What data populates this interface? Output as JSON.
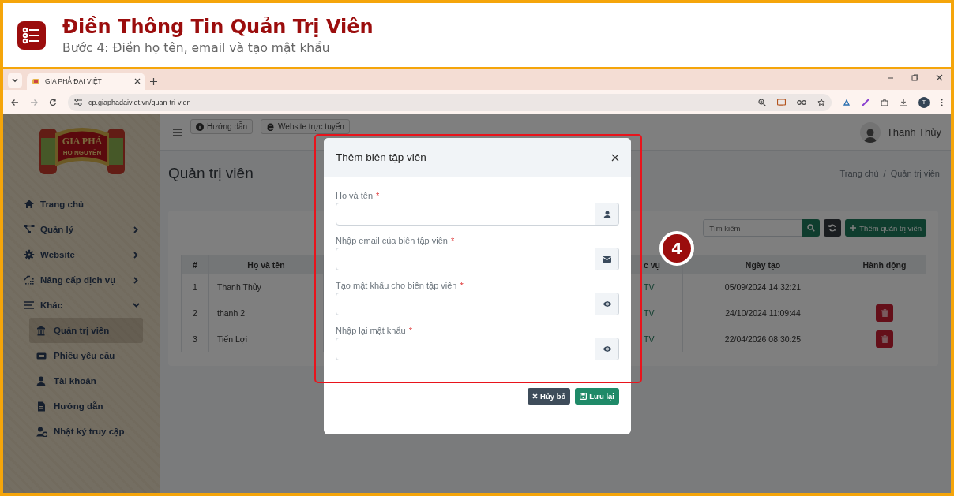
{
  "tutorial_header": {
    "title": "Điền Thông Tin Quản Trị Viên",
    "subtitle": "Bước 4: Điền họ tên, email và tạo mật khẩu"
  },
  "browser": {
    "tab_title": "GIA PHẢ ĐẠI VIỆT",
    "url": "cp.giaphadaiviet.vn/quan-tri-vien",
    "profile_initial": "T"
  },
  "sidebar": {
    "logo": {
      "title": "GIA PHẢ",
      "subtitle": "HỌ NGUYỄN"
    },
    "items": [
      {
        "label": "Trang chủ",
        "expandable": false,
        "expanded": false,
        "selected": false
      },
      {
        "label": "Quản lý",
        "expandable": true,
        "expanded": false,
        "selected": false
      },
      {
        "label": "Website",
        "expandable": true,
        "expanded": false,
        "selected": false
      },
      {
        "label": "Nâng cấp dịch vụ",
        "expandable": true,
        "expanded": false,
        "selected": false
      },
      {
        "label": "Khác",
        "expandable": true,
        "expanded": true,
        "selected": false,
        "children": [
          {
            "label": "Quản trị viên",
            "selected": true
          },
          {
            "label": "Phiếu yêu cầu",
            "selected": false
          },
          {
            "label": "Tài khoản",
            "selected": false
          },
          {
            "label": "Hướng dẫn",
            "selected": false
          },
          {
            "label": "Nhật ký truy cập",
            "selected": false
          }
        ]
      }
    ]
  },
  "topbar": {
    "buttons": [
      "Hướng dẫn",
      "Website trực tuyến"
    ],
    "user_name": "Thanh Thủy"
  },
  "page": {
    "title": "Quản trị viên",
    "breadcrumb": [
      "Trang chủ",
      "Quản trị viên"
    ],
    "breadcrumb_separator": "/"
  },
  "toolbar": {
    "search_placeholder": "Tìm kiếm",
    "add_button": "Thêm quản trị viên"
  },
  "table": {
    "columns": [
      "#",
      "Họ và tên",
      "c vụ",
      "Ngày tạo",
      "Hành động"
    ],
    "rows": [
      {
        "cells": [
          "1",
          "Thanh Thủy",
          "TV",
          "05/09/2024 14:32:21"
        ],
        "deletable": false
      },
      {
        "cells": [
          "2",
          "thanh 2",
          "TV",
          "24/10/2024 11:09:44"
        ],
        "deletable": true
      },
      {
        "cells": [
          "3",
          "Tiến Lợi",
          "TV",
          "22/04/2026 08:30:25"
        ],
        "deletable": true
      }
    ]
  },
  "modal": {
    "title": "Thêm biên tập viên",
    "fields": [
      {
        "label": "Họ và tên",
        "mark": "*"
      },
      {
        "label": "Nhập email của biên tập viên",
        "mark": "*"
      },
      {
        "label": "Tạo mật khẩu cho biên tập viên",
        "mark": "*"
      },
      {
        "label": "Nhập lại mật khẩu",
        "mark": "*"
      }
    ],
    "buttons": [
      {
        "label": "Hủy bỏ",
        "kind": "cancel"
      },
      {
        "label": "Lưu lại",
        "kind": "save"
      }
    ]
  },
  "step_badge": "4"
}
